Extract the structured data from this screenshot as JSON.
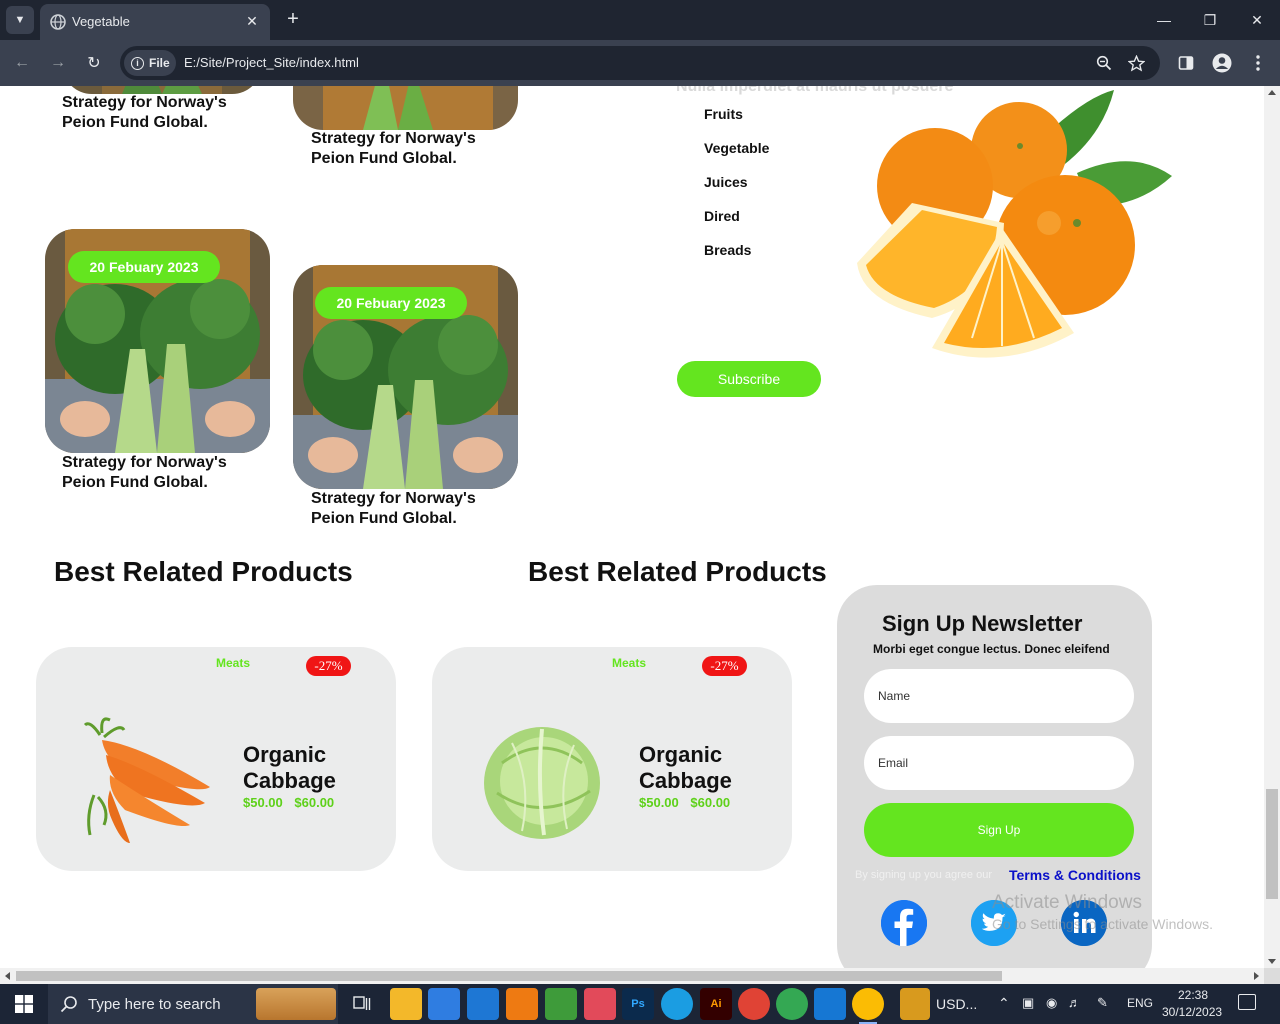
{
  "browser": {
    "tab_title": "Vegetable",
    "new_tab": "+",
    "site_chip": "File",
    "url": "E:/Site/Project_Site/index.html"
  },
  "page": {
    "faded_heading": "Nulla imperdiet at mauris ut posuere",
    "blog_posts": [
      {
        "date": "",
        "caption": "Strategy for Norway's Peion Fund Global."
      },
      {
        "date": "",
        "caption": "Strategy for Norway's Peion Fund Global."
      },
      {
        "date": "20 Febuary 2023",
        "caption": "Strategy for Norway's Peion Fund Global."
      },
      {
        "date": "20 Febuary 2023",
        "caption": "Strategy for Norway's Peion Fund Global."
      }
    ],
    "categories": [
      "Fruits",
      "Vegetable",
      "Juices",
      "Dired",
      "Breads"
    ],
    "subscribe_label": "Subscribe",
    "section_titles": [
      "Best Related Products",
      "Best Related Products"
    ],
    "products": [
      {
        "category": "Meats",
        "discount": "-27%",
        "name": "Organic Cabbage",
        "price_new": "$50.00",
        "price_old": "$60.00",
        "image": "carrot"
      },
      {
        "category": "Meats",
        "discount": "-27%",
        "name": "Organic Cabbage",
        "price_new": "$50.00",
        "price_old": "$60.00",
        "image": "cabbage"
      }
    ],
    "newsletter": {
      "title": "Sign Up Newsletter",
      "subtitle": "Morbi eget congue lectus. Donec eleifend",
      "name_placeholder": "Name",
      "email_placeholder": "Email",
      "button": "Sign Up",
      "agree_text": "By signing up you agree our",
      "terms": "Terms & Conditions",
      "socials": [
        "facebook-icon",
        "twitter-icon",
        "linkedin-icon"
      ]
    },
    "watermark": {
      "line1": "Activate Windows",
      "line2": "Go to Settings to activate Windows."
    }
  },
  "taskbar": {
    "search_placeholder": "Type here to search",
    "weather": "USD...",
    "language": "ENG",
    "time": "22:38",
    "date": "30/12/2023"
  },
  "colors": {
    "accent_green": "#64e51f",
    "discount_red": "#f01515",
    "terms_blue": "#0a10c9",
    "card_bg": "#ebecec",
    "newsletter_bg": "#dcdcdc"
  }
}
